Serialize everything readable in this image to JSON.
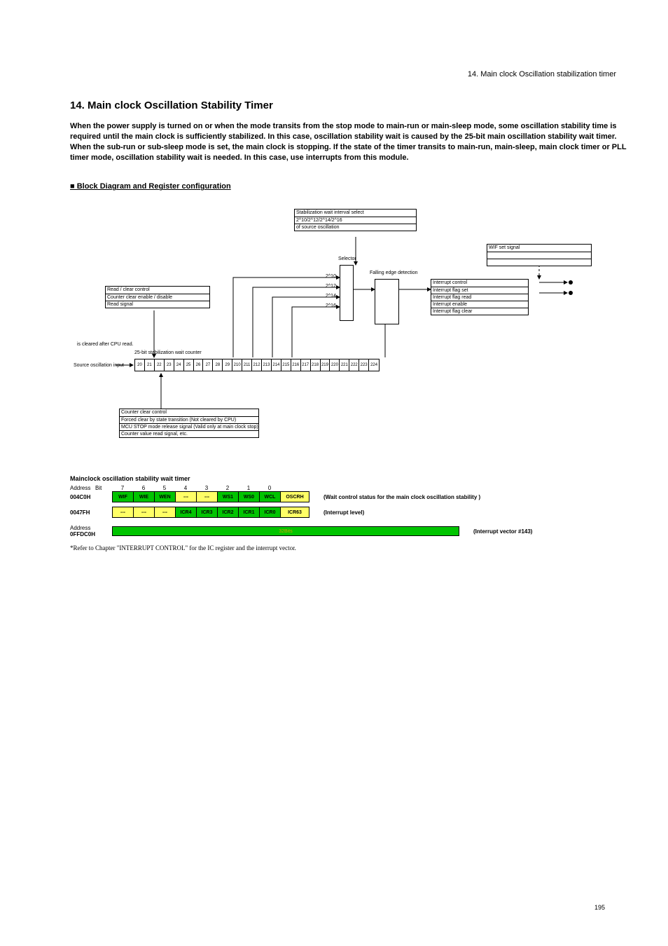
{
  "section_header_right": "14. Main clock Oscillation stabilization timer",
  "chapter_title": "14. Main clock Oscillation Stability Timer",
  "intro": "When the power supply is turned on or when the mode transits from the stop mode to main-run or main-sleep mode, some oscillation stability time is required until the main clock is sufficiently stabilized. In this case, oscillation stability wait is caused by the 25-bit main oscillation stability wait timer. When the sub-run or sub-sleep mode is set, the main clock is stopping. If the state of the timer transits to main-run, main-sleep, main clock timer or PLL timer mode, oscillation stability wait is needed. In this case, use interrupts from this module.",
  "block_hdr": "■ Block Diagram and Register configuration",
  "fig": {
    "read_clear_box": {
      "r0": "Read / clear control",
      "r1": "Counter clear enable / disable",
      "r2": "Read signal"
    },
    "stab_box": {
      "r0": "Stabilization wait interval select",
      "r1": "2^10/2^12/2^14/2^16",
      "r2": "of source oscillation"
    },
    "sel": "Selector",
    "int_box": {
      "r0": "Interrupt control",
      "r1": "Interrupt flag set",
      "r2": "Interrupt flag read",
      "r3": "Interrupt enable",
      "r4": "Interrupt flag clear"
    },
    "edge": "Falling edge detection",
    "wif_lbl": "WIF set signal",
    "sel_lbls": {
      "l10": "2^10",
      "l12": "2^12",
      "l14": "2^14",
      "l16": "2^16"
    },
    "sr_label": "25-bit stabilization wait counter",
    "sr_left": "is cleared after CPU read.",
    "sr_src": "Source oscillation input",
    "sr_cells": [
      "20",
      "21",
      "22",
      "23",
      "24",
      "25",
      "26",
      "27",
      "28",
      "29",
      "210",
      "211",
      "212",
      "213",
      "214",
      "215",
      "216",
      "217",
      "218",
      "219",
      "220",
      "221",
      "222",
      "223",
      "224"
    ],
    "ctrl_box": {
      "r0": "Counter clear control",
      "r1": "Forced clear by state transition (Not cleared by CPU)",
      "r2": "MCU STOP mode release signal (Valid only at main clock stop)",
      "r3": "Counter value read signal, etc."
    }
  },
  "reg": {
    "title": "Mainclock oscillation stability wait timer",
    "addr_label": "Address",
    "bit_label": "Bit",
    "bitnums": [
      "7",
      "6",
      "5",
      "4",
      "3",
      "2",
      "1",
      "0",
      ""
    ],
    "r1_addr": "004C0H",
    "r1_cells": [
      {
        "t": "WIF",
        "c": "g"
      },
      {
        "t": "WIE",
        "c": "g"
      },
      {
        "t": "WEN",
        "c": "g"
      },
      {
        "t": "---",
        "c": "y"
      },
      {
        "t": "---",
        "c": "y"
      },
      {
        "t": "WS1",
        "c": "g"
      },
      {
        "t": "WS0",
        "c": "g"
      },
      {
        "t": "WCL",
        "c": "g"
      },
      {
        "t": "OSCRH",
        "c": "last"
      }
    ],
    "r1_desc": "(Wait control status for the main clock oscillation stability )",
    "r2_addr": "0047FH",
    "r2_cells": [
      {
        "t": "---",
        "c": "y"
      },
      {
        "t": "---",
        "c": "y"
      },
      {
        "t": "---",
        "c": "y"
      },
      {
        "t": "ICR4",
        "c": "g"
      },
      {
        "t": "ICR3",
        "c": "g"
      },
      {
        "t": "ICR2",
        "c": "g"
      },
      {
        "t": "ICR1",
        "c": "g"
      },
      {
        "t": "ICR0",
        "c": "g"
      },
      {
        "t": "ICR63",
        "c": "last"
      }
    ],
    "r2_desc": "(Interrupt level)",
    "vec_addr_lbl": "Address",
    "vec_addr": "0FFDC0H",
    "vec_text": "32Bits",
    "vec_desc": "(Interrupt vector  #143)",
    "footnote": "*Refer to Chapter \"INTERRUPT CONTROL\" for the IC register and the interrupt vector."
  },
  "pagenum": "195"
}
